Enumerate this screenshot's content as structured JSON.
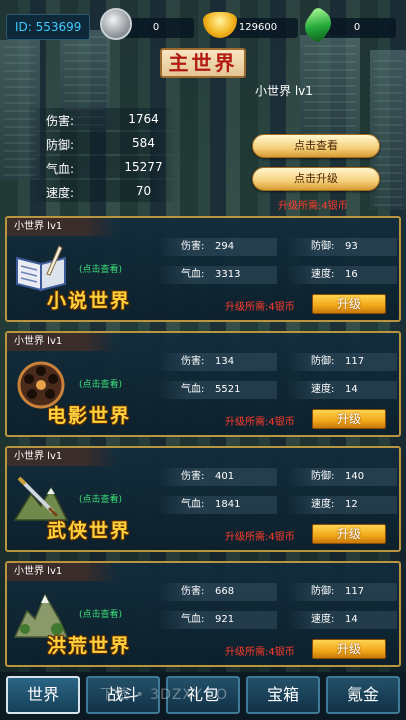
{
  "topbar": {
    "id_label": "ID: 553699",
    "silver": "0",
    "ingot": "129600",
    "gem": "0"
  },
  "main": {
    "title": "主世界",
    "level": "小世界 lv1",
    "stats": [
      {
        "label": "伤害:",
        "value": "1764"
      },
      {
        "label": "防御:",
        "value": "584"
      },
      {
        "label": "气血:",
        "value": "15277"
      },
      {
        "label": "速度:",
        "value": "70"
      }
    ],
    "view_button": "点击查看",
    "upgrade_button": "点击升级",
    "upgrade_req": "升级所需:4银币"
  },
  "worlds": [
    {
      "tag": "小世界 lv1",
      "name": "小说世界",
      "view": "(点击查看)",
      "damage_label": "伤害:",
      "damage": "294",
      "defense_label": "防御:",
      "defense": "93",
      "hp_label": "气血:",
      "hp": "3313",
      "speed_label": "速度:",
      "speed": "16",
      "req": "升级所需:4银币",
      "button": "升级",
      "icon": "book-quill-icon"
    },
    {
      "tag": "小世界 lv1",
      "name": "电影世界",
      "view": "(点击查看)",
      "damage_label": "伤害:",
      "damage": "134",
      "defense_label": "防御:",
      "defense": "117",
      "hp_label": "气血:",
      "hp": "5521",
      "speed_label": "速度:",
      "speed": "14",
      "req": "升级所需:4银币",
      "button": "升级",
      "icon": "film-reel-icon"
    },
    {
      "tag": "小世界 lv1",
      "name": "武侠世界",
      "view": "(点击查看)",
      "damage_label": "伤害:",
      "damage": "401",
      "defense_label": "防御:",
      "defense": "140",
      "hp_label": "气血:",
      "hp": "1841",
      "speed_label": "速度:",
      "speed": "12",
      "req": "升级所需:4银币",
      "button": "升级",
      "icon": "sword-mountain-icon"
    },
    {
      "tag": "小世界 lv1",
      "name": "洪荒世界",
      "view": "(点击查看)",
      "damage_label": "伤害:",
      "damage": "668",
      "defense_label": "防御:",
      "defense": "117",
      "hp_label": "气血:",
      "hp": "921",
      "speed_label": "速度:",
      "speed": "14",
      "req": "升级所需:4银币",
      "button": "升级",
      "icon": "ancient-mountain-icon"
    }
  ],
  "nav": {
    "items": [
      "世界",
      "战斗",
      "礼包",
      "宝箱",
      "氪金"
    ],
    "active": "世界"
  },
  "watermark": "下载 • 3DZXY.CO"
}
